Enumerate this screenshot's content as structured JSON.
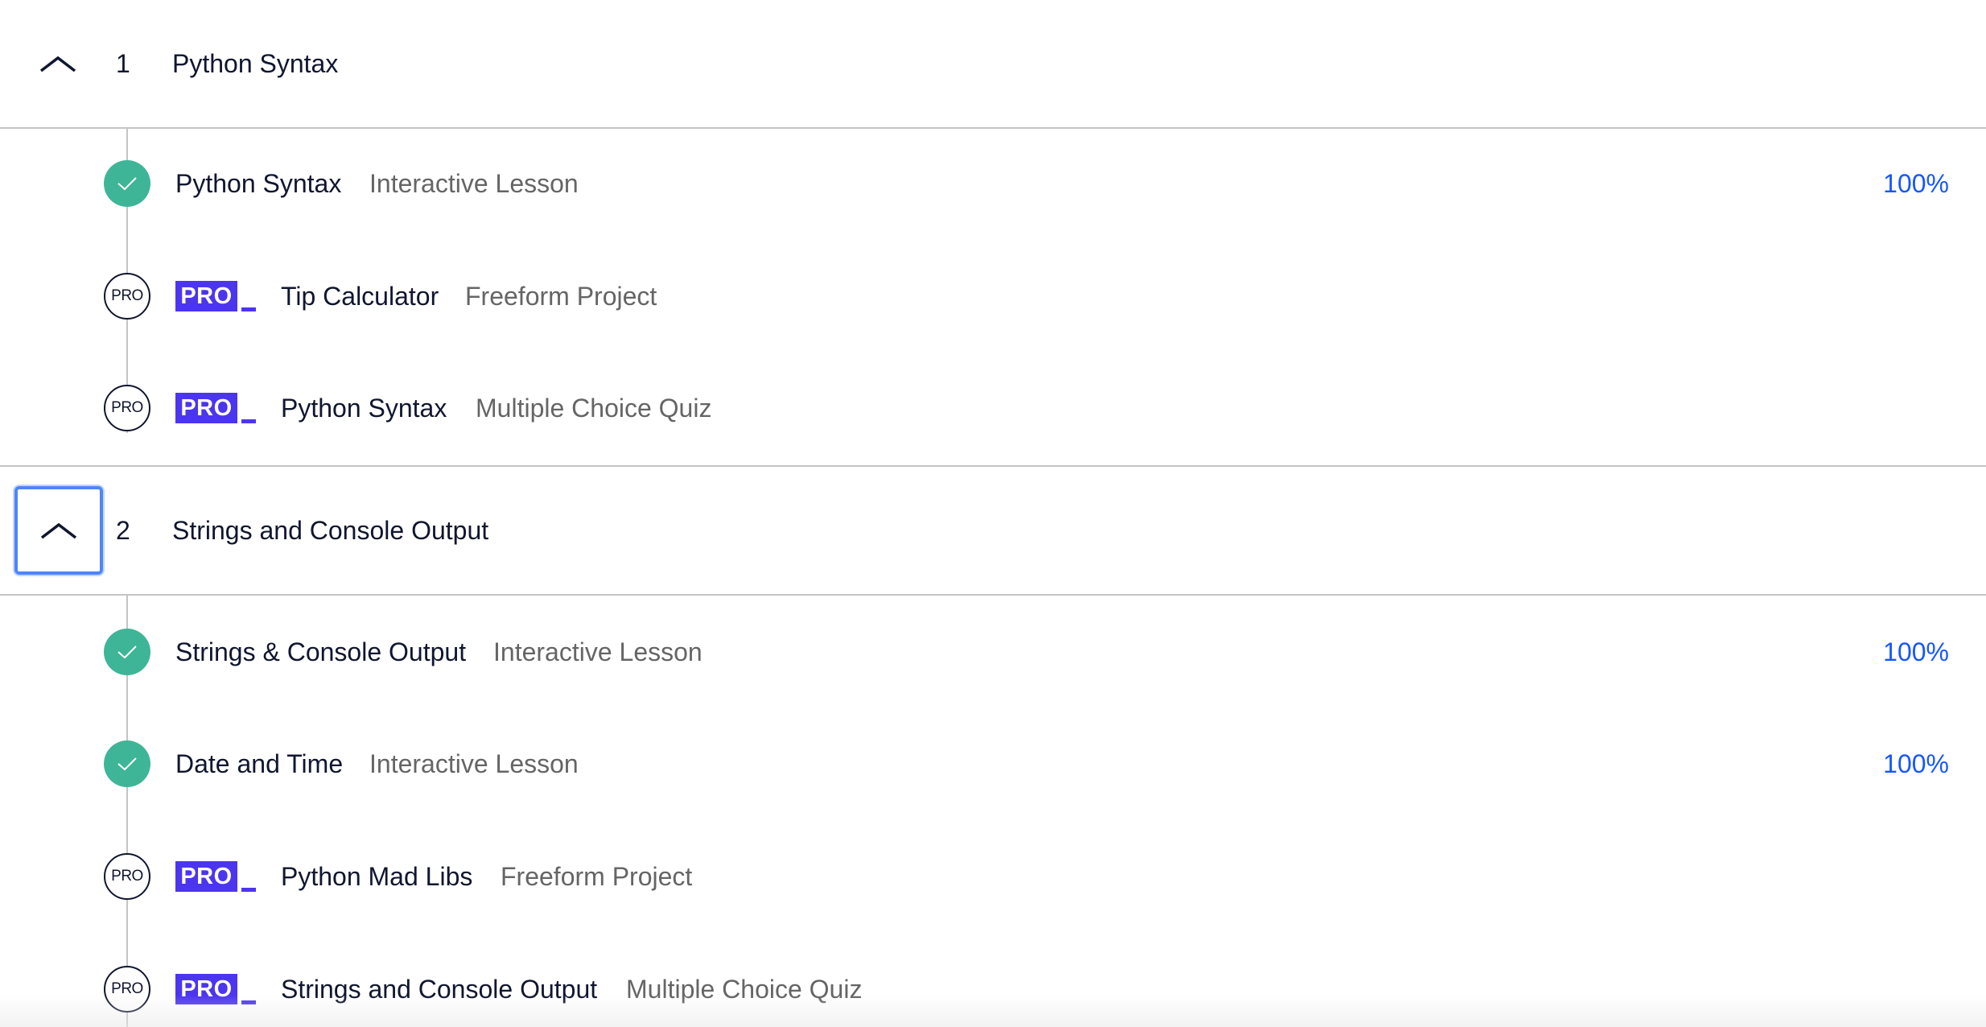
{
  "modules": [
    {
      "number": "1",
      "title": "Python Syntax",
      "items": [
        {
          "status": "done",
          "title": "Python Syntax",
          "type": "Interactive Lesson",
          "progress": "100%"
        },
        {
          "status": "pro",
          "badge": "PRO",
          "title": "Tip Calculator",
          "type": "Freeform Project"
        },
        {
          "status": "pro",
          "badge": "PRO",
          "title": "Python Syntax",
          "type": "Multiple Choice Quiz"
        }
      ]
    },
    {
      "number": "2",
      "title": "Strings and Console Output",
      "items": [
        {
          "status": "done",
          "title": "Strings & Console Output",
          "type": "Interactive Lesson",
          "progress": "100%"
        },
        {
          "status": "done",
          "title": "Date and Time",
          "type": "Interactive Lesson",
          "progress": "100%"
        },
        {
          "status": "pro",
          "badge": "PRO",
          "title": "Python Mad Libs",
          "type": "Freeform Project"
        },
        {
          "status": "pro",
          "badge": "PRO",
          "title": "Strings and Console Output",
          "type": "Multiple Choice Quiz"
        }
      ]
    }
  ],
  "pro_status_label": "PRO",
  "colors": {
    "done": "#3fb598",
    "pro_badge": "#4b35ef",
    "progress": "#1557ff",
    "focus": "#4f86f7"
  }
}
